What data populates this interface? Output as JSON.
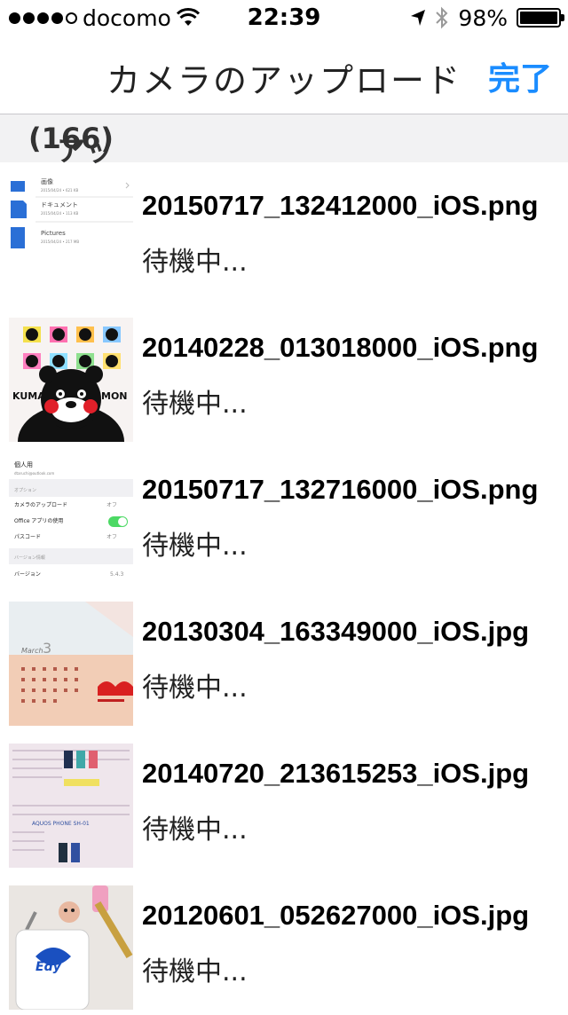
{
  "status_bar": {
    "carrier": "docomo",
    "time": "22:39",
    "battery": "98%",
    "signal_bars_filled": 4,
    "signal_bars_total": 5,
    "icons": [
      "wifi-icon",
      "location-arrow-icon",
      "bluetooth-icon",
      "battery-icon"
    ]
  },
  "nav": {
    "title": "カメラのアップロード",
    "done_label": "完了",
    "accent_color": "#1a8cff"
  },
  "section": {
    "label": "アップロード中",
    "count": "(166)"
  },
  "uploads": [
    {
      "filename": "20150717_132412000_iOS.png",
      "status": "待機中..."
    },
    {
      "filename": "20140228_013018000_iOS.png",
      "status": "待機中..."
    },
    {
      "filename": "20150717_132716000_iOS.png",
      "status": "待機中..."
    },
    {
      "filename": "20130304_163349000_iOS.jpg",
      "status": "待機中..."
    },
    {
      "filename": "20140720_213615253_iOS.jpg",
      "status": "待機中..."
    },
    {
      "filename": "20120601_052627000_iOS.jpg",
      "status": "待機中..."
    }
  ],
  "thumb_text": {
    "t1": [
      "画像",
      "2015/04/24 • 621 KB",
      "ドキュメント",
      "2015/04/24 • 113 KB",
      "Pictures",
      "2015/04/24 • 217 MB"
    ],
    "t2": [
      "KUMA",
      "MON"
    ],
    "t3": [
      "個人用",
      "dtaruchi@outlook.com",
      "オプション",
      "カメラのアップロード",
      "オフ",
      "Office アプリの使用",
      "パスコード",
      "オフ",
      "バージョン情報",
      "バージョン",
      "5.4.3"
    ],
    "t4": [
      "March",
      "3"
    ],
    "t5": [
      "AQUOS PHONE SH-01"
    ],
    "t6": [
      "Edy"
    ]
  }
}
